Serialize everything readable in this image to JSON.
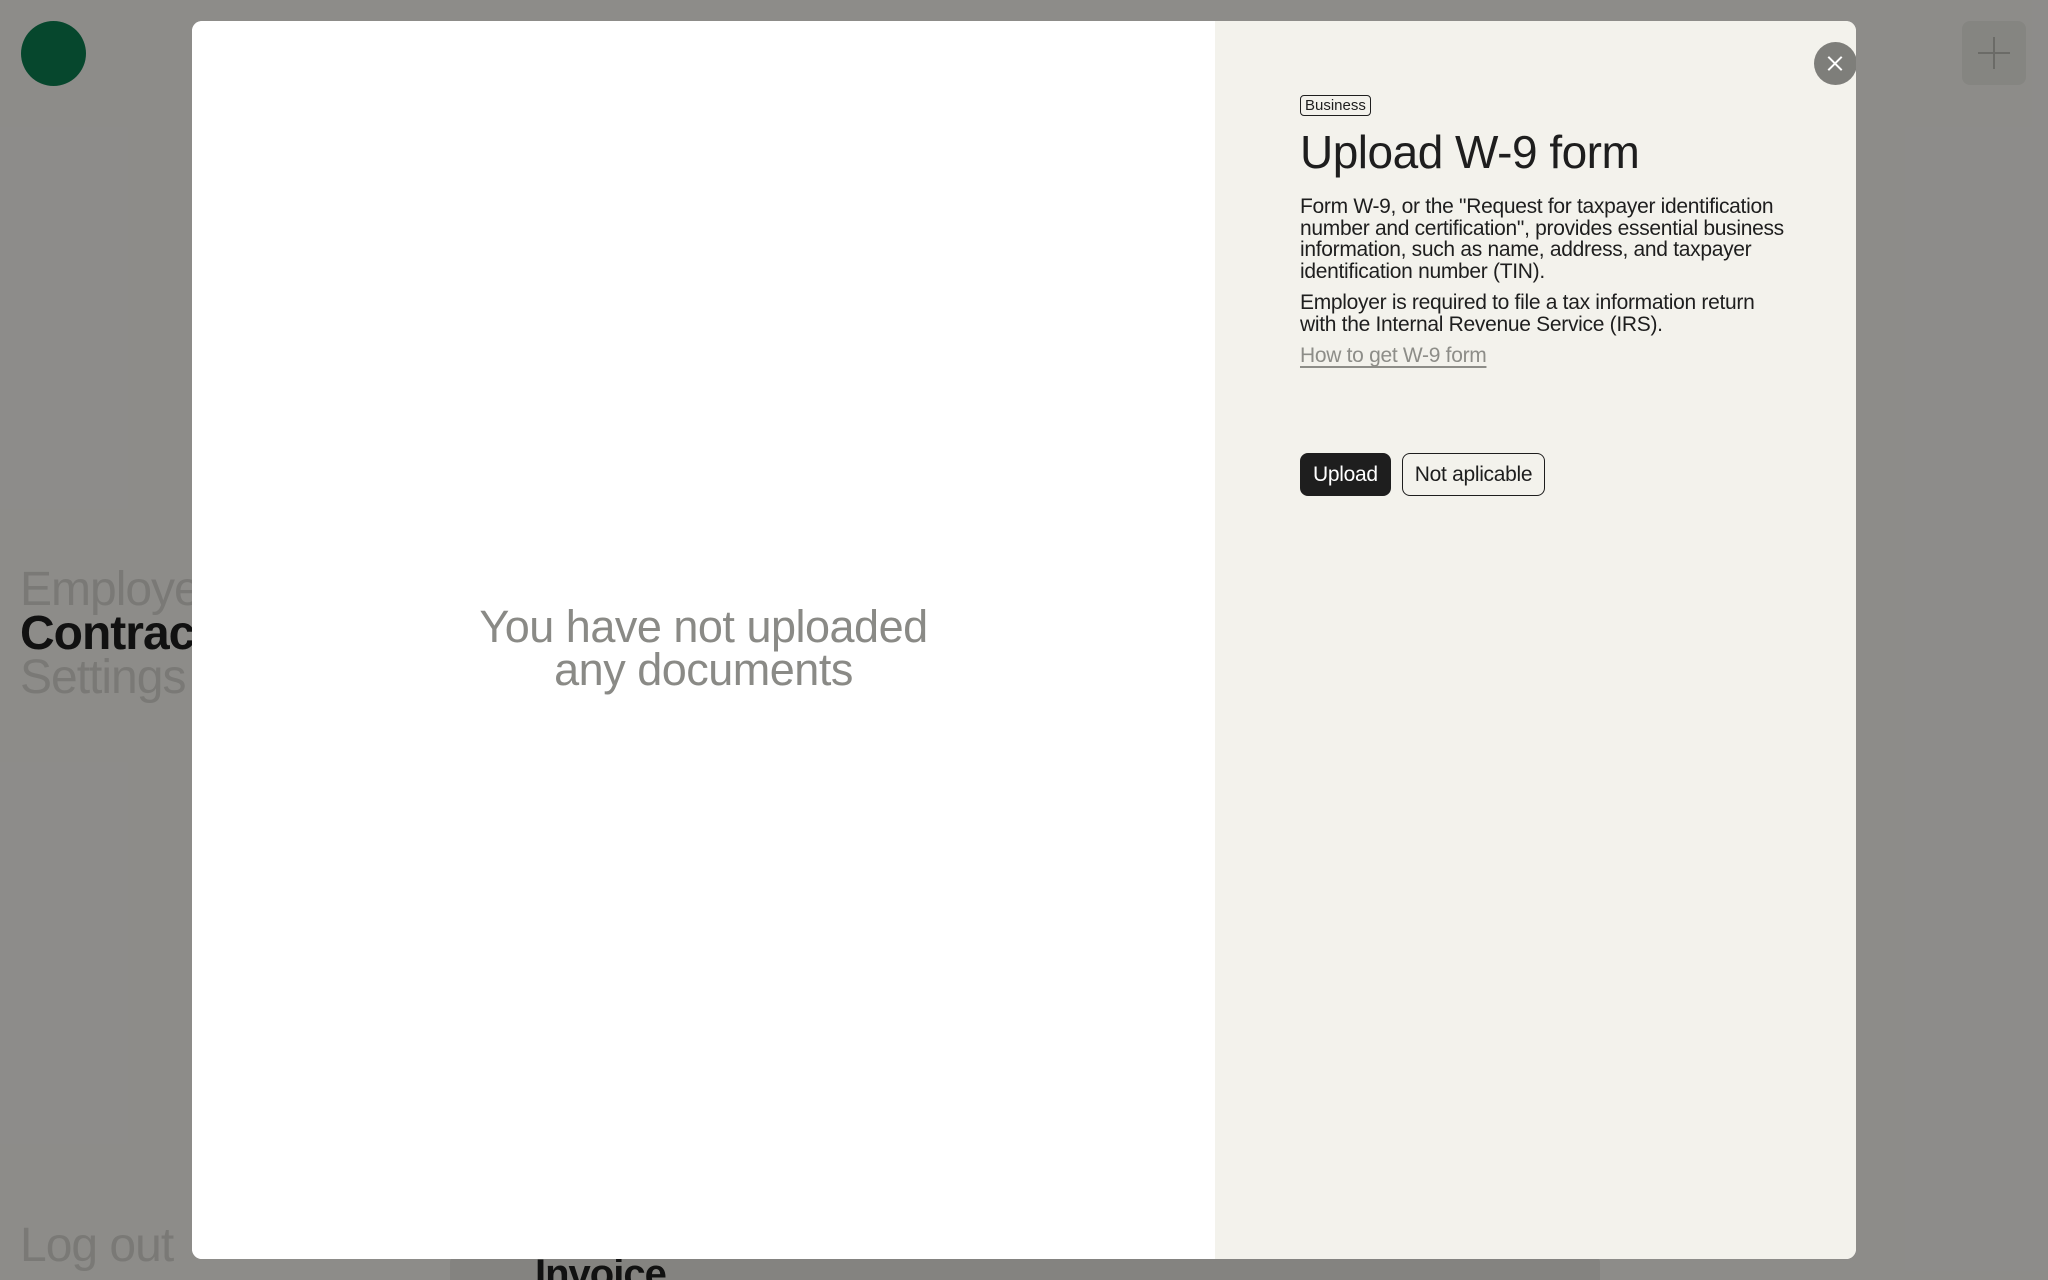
{
  "background": {
    "nav": {
      "items": [
        {
          "label": "Employer",
          "active": false
        },
        {
          "label": "Contractor",
          "active": true
        },
        {
          "label": "Settings",
          "active": false
        }
      ],
      "logout_label": "Log out"
    },
    "bottom_text": "Invoice"
  },
  "modal": {
    "empty_message": "You have not uploaded any documents",
    "tag": "Business",
    "title": "Upload W-9 form",
    "description_1": "Form W-9, or the \"Request for taxpayer identification number and certification\", provides essential business information, such as name, address, and taxpayer identification number (TIN).",
    "description_2": "Employer is required to file a tax information return with the Internal Revenue Service (IRS).",
    "help_link": "How to get W-9 form",
    "upload_label": "Upload",
    "not_applicable_label": "Not aplicable"
  },
  "colors": {
    "brand": "#0c7a4f",
    "primary_button": "#1e1e1e",
    "panel_background": "#f3f2ec"
  },
  "icons": {
    "close": "close-icon",
    "add": "plus-icon"
  }
}
